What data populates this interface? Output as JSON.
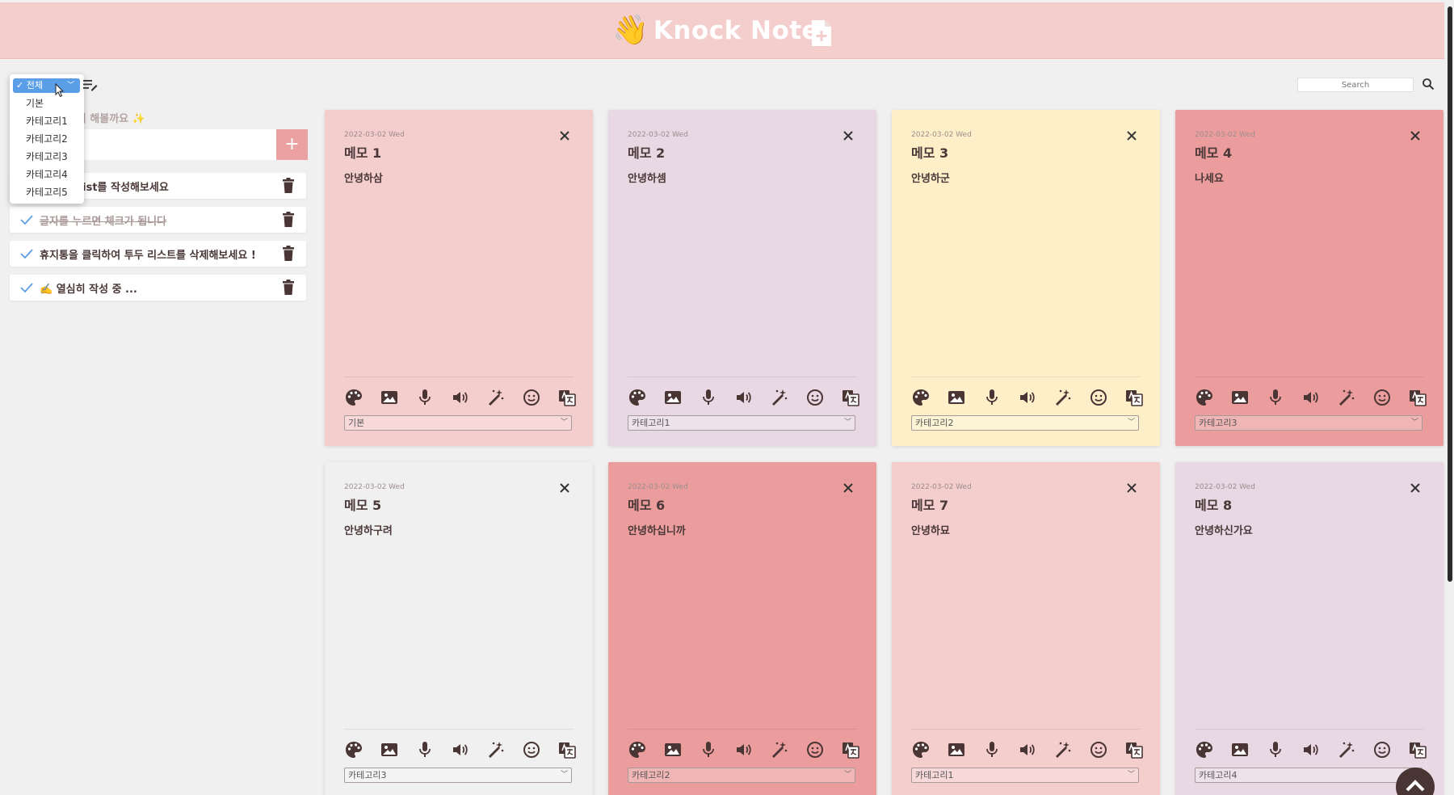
{
  "header": {
    "brand_emoji": "👋",
    "title": "Knock Note",
    "new_note_icon": "file-plus-icon"
  },
  "search": {
    "placeholder": "Search",
    "icon": "search-icon"
  },
  "filter": {
    "selected": "전체",
    "options": [
      "기본",
      "카테고리1",
      "카테고리2",
      "카테고리3",
      "카테고리4",
      "카테고리5"
    ]
  },
  "todo": {
    "title": "할 일을 미리미리 해볼까요 ✨",
    "add_label": "+",
    "items": [
      {
        "text": "To Do List를 작성해보세요",
        "done": false
      },
      {
        "text": "글자를 누르면 체크가 됩니다",
        "done": true
      },
      {
        "text": "휴지통을 클릭하여 투두 리스트를 삭제해보세요 !",
        "done": false
      },
      {
        "text": "✍️ 열심히 작성 중 ...",
        "done": false
      }
    ]
  },
  "memos": [
    {
      "date": "2022-03-02 Wed",
      "title": "메모 1",
      "body": "안녕하삼",
      "category": "기본",
      "color": "#f4cdcd"
    },
    {
      "date": "2022-03-02 Wed",
      "title": "메모 2",
      "body": "안녕하셈",
      "category": "카테고리1",
      "color": "#e8d8e3"
    },
    {
      "date": "2022-03-02 Wed",
      "title": "메모 3",
      "body": "안녕하군",
      "category": "카테고리2",
      "color": "#fdf0c9"
    },
    {
      "date": "2022-03-02 Wed",
      "title": "메모 4",
      "body": "나세요",
      "category": "카테고리3",
      "color": "#eb9d9d"
    },
    {
      "date": "2022-03-02 Wed",
      "title": "메모 5",
      "body": "안녕하구려",
      "category": "카테고리3",
      "color": "#f1f0f0"
    },
    {
      "date": "2022-03-02 Wed",
      "title": "메모 6",
      "body": "안녕하십니까",
      "category": "카테고리2",
      "color": "#eb9d9d"
    },
    {
      "date": "2022-03-02 Wed",
      "title": "메모 7",
      "body": "안녕하묘",
      "category": "카테고리1",
      "color": "#f4cdcd"
    },
    {
      "date": "2022-03-02 Wed",
      "title": "메모 8",
      "body": "안녕하신가요",
      "category": "카테고리4",
      "color": "#e8d8e3"
    }
  ],
  "memo_tool_icons": [
    "palette-icon",
    "image-icon",
    "microphone-icon",
    "speaker-icon",
    "magic-wand-icon",
    "smiley-icon",
    "translate-icon"
  ],
  "colors": {
    "header_bg": "#f4cdcd",
    "accent": "#eba1a1",
    "text": "#4a3838",
    "filter_blue": "#5b9ee8"
  }
}
